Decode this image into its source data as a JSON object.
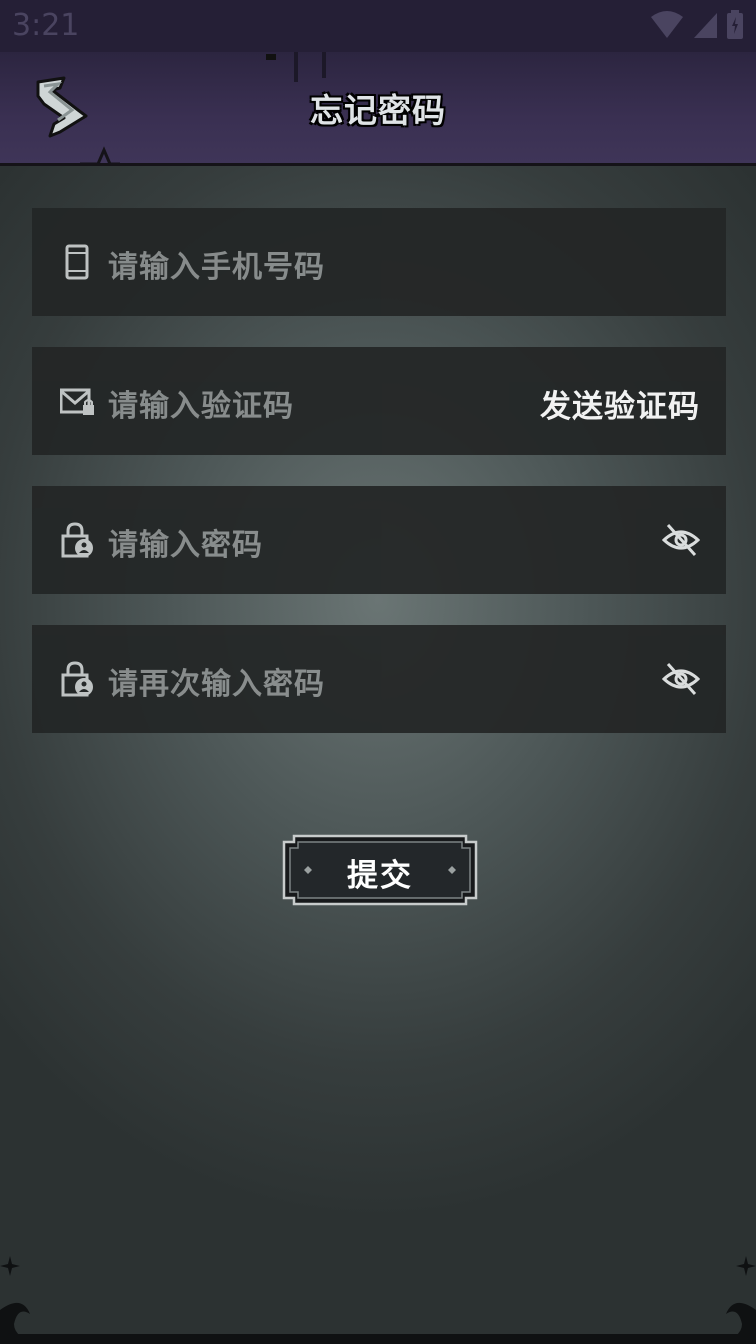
{
  "status_bar": {
    "time": "3:21"
  },
  "header": {
    "title": "忘记密码"
  },
  "form": {
    "phone_placeholder": "请输入手机号码",
    "code_placeholder": "请输入验证码",
    "send_code_label": "发送验证码",
    "password_placeholder": "请输入密码",
    "confirm_password_placeholder": "请再次输入密码",
    "submit_label": "提交"
  },
  "colors": {
    "header_bg": "#3a3052",
    "field_bg": "#232626",
    "placeholder_text": "#8d9191",
    "accent_text": "#ffffff"
  }
}
